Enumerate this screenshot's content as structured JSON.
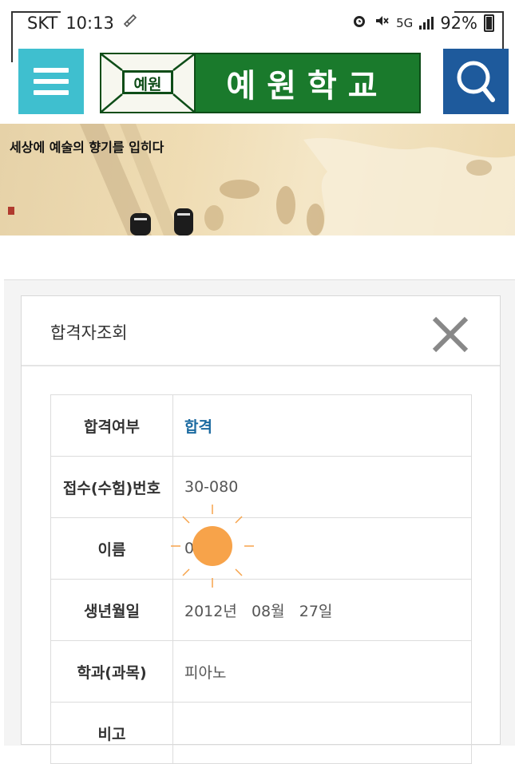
{
  "status_bar": {
    "carrier": "SKT",
    "time": "10:13",
    "network": "5G",
    "battery": "92%"
  },
  "header": {
    "logo_seal_text": "예원",
    "logo_name": "예원학교"
  },
  "banner": {
    "tagline": "세상에 예술의 향기를 입히다"
  },
  "dialog": {
    "title": "합격자조회",
    "rows": [
      {
        "label": "합격여부",
        "value": "합격"
      },
      {
        "label": "접수(수험)번호",
        "value": "30-080"
      },
      {
        "label": "이름",
        "value": "0"
      },
      {
        "label": "생년월일",
        "value": "2012년   08월   27일"
      },
      {
        "label": "학과(과목)",
        "value": "피아노"
      },
      {
        "label": "비고",
        "value": ""
      }
    ]
  },
  "colors": {
    "menu_button": "#3fbfcf",
    "logo_green": "#1a7a2c",
    "search_button": "#1e5a9c",
    "pass_text": "#1b6aa0",
    "sun": "#f7a34a"
  },
  "icons": [
    "hamburger-menu-icon",
    "search-icon",
    "close-icon",
    "alarm-icon",
    "mute-icon",
    "sync-icon",
    "battery-icon",
    "sun-sticker-icon"
  ]
}
